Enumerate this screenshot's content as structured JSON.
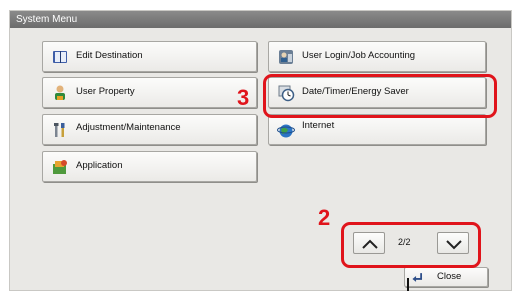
{
  "window": {
    "title": "System Menu"
  },
  "buttons": {
    "edit_destination": "Edit Destination",
    "user_login": "User Login/Job Accounting",
    "user_property": "User Property",
    "date_timer": "Date/Timer/Energy Saver",
    "adjustment": "Adjustment/Maintenance",
    "internet": "Internet",
    "application": "Application"
  },
  "icons": {
    "edit_destination": "address-book-icon",
    "user_login": "user-login-icon",
    "user_property": "user-property-icon",
    "date_timer": "clock-icon",
    "adjustment": "wrench-screwdriver-icon",
    "internet": "globe-icon",
    "application": "application-icon",
    "close": "close-return-icon"
  },
  "pagination": {
    "indicator": "2/2",
    "close_label": "Close"
  },
  "annotations": {
    "step_3": "3",
    "step_2": "2",
    "color": "#e0141b"
  }
}
